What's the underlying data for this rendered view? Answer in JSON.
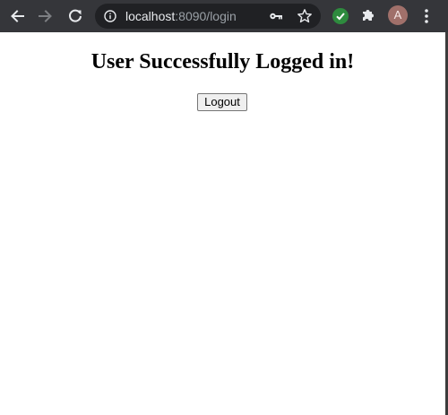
{
  "browser": {
    "url_host": "localhost",
    "url_rest": ":8090/login",
    "avatar_letter": "A",
    "icons": {
      "back": "arrow-back-icon",
      "forward": "arrow-forward-icon",
      "reload": "reload-icon",
      "site_info": "info-icon",
      "password": "key-icon",
      "bookmark": "star-icon",
      "extension": "check-circle-icon",
      "extensions_menu": "puzzle-icon",
      "menu": "kebab-menu-icon"
    },
    "colors": {
      "toolbar": "#35363a",
      "omnibox": "#202124",
      "extension_green": "#2e8b3e",
      "avatar": "#a0706a"
    }
  },
  "page": {
    "heading": "User Successfully Logged in!",
    "logout_label": "Logout"
  }
}
